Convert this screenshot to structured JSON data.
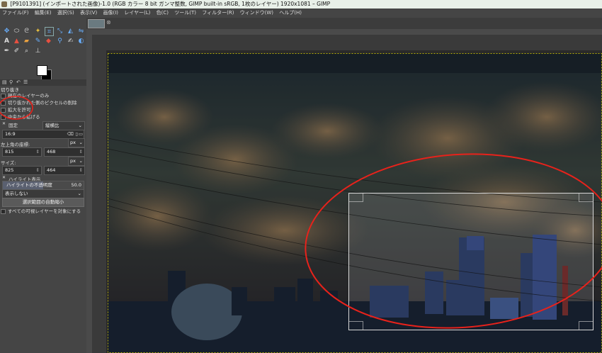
{
  "window": {
    "title": "[P9101391] (インポートされた画像)-1.0 (RGB カラー 8 bit ガンマ整数, GIMP built-in sRGB, 1枚のレイヤー) 1920x1081 – GIMP"
  },
  "menu": {
    "items": [
      "ファイル(F)",
      "編集(E)",
      "選択(S)",
      "表示(V)",
      "画像(I)",
      "レイヤー(L)",
      "色(C)",
      "ツール(T)",
      "フィルター(R)",
      "ウィンドウ(W)",
      "ヘルプ(H)"
    ]
  },
  "tool_options": {
    "section_title": "切り抜き",
    "current_layer_only": "現在のレイヤーのみ",
    "delete_cropped_pixels": "切り抜かれた側のピクセルの削除",
    "allow_growing": "拡大を許可",
    "expand_from_center": "中央から拡げる",
    "fixed_label": "固定",
    "fixed_mode": "縦横比",
    "ratio_value": "16:9",
    "position_label": "左上角の座標:",
    "position_unit": "px",
    "position_x": "815",
    "position_y": "468",
    "size_label": "サイズ:",
    "size_unit": "px",
    "size_w": "825",
    "size_h": "464",
    "highlight_label": "ハイライト表示",
    "highlight_opacity_label": "ハイライトの不透明度",
    "highlight_opacity_value": "50.0",
    "guides_value": "表示しない",
    "auto_shrink_button": "選択範囲の自動縮小",
    "shrink_merged": "すべての可視レイヤーを対象にする"
  },
  "colors": {
    "accent_red": "#e8221b",
    "crop_border": "#d8d8d8",
    "selection_marching": "#f0e000"
  },
  "icons": [
    "move-icon",
    "rect-select-icon",
    "lasso-icon",
    "fuzzy-select-icon",
    "crop-icon",
    "unified-transform-icon",
    "warp-icon",
    "flip-icon",
    "text-icon",
    "bucket-fill-icon",
    "gradient-icon",
    "paintbrush-icon",
    "eraser-icon",
    "clone-icon",
    "smudge-icon",
    "dodge-icon",
    "path-icon",
    "color-picker-icon",
    "zoom-icon",
    "measure-icon"
  ]
}
